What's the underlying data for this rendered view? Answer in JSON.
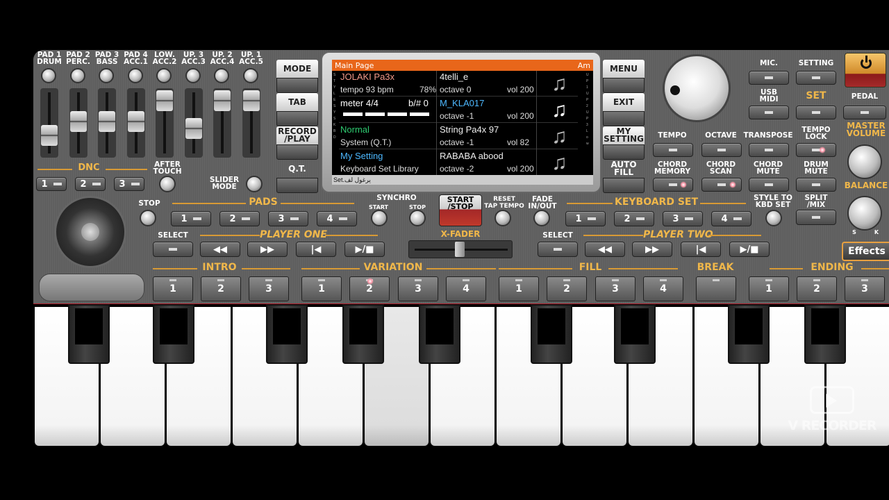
{
  "top_sliders": [
    {
      "label": "PAD 1\nDRUM"
    },
    {
      "label": "PAD 2\nPERC."
    },
    {
      "label": "PAD 3\nBASS"
    },
    {
      "label": "PAD 4\nACC.1"
    },
    {
      "label": "LOW.\nACC.2"
    },
    {
      "label": "UP. 3\nACC.3"
    },
    {
      "label": "UP. 2\nACC.4"
    },
    {
      "label": "UP. 1\nACC.5"
    }
  ],
  "dnc": {
    "label": "DNC",
    "buttons": [
      "1",
      "2",
      "3"
    ]
  },
  "after_touch": "AFTER\nTOUCH",
  "slider_mode": "SLIDER\nMODE",
  "left_col": {
    "mode": "MODE",
    "tab": "TAB",
    "record": "RECORD\n/PLAY",
    "qt": "Q.T."
  },
  "right_col": {
    "menu": "MENU",
    "exit": "EXIT",
    "my_setting": "MY\nSETTING",
    "auto_fill": "AUTO\nFILL"
  },
  "screen": {
    "header": "Main Page",
    "chord": "Am",
    "left_tags": [
      "S",
      "T",
      "Y",
      "L",
      "E",
      "S",
      "Y",
      "S",
      "K",
      "B",
      "D"
    ],
    "right_tags": [
      "U",
      "P",
      "1",
      "U",
      "P",
      "2",
      "U",
      "P",
      "3",
      "L",
      "o",
      "w"
    ],
    "style_name": "JOLAKI  Pa3x",
    "tempo": "tempo 93 bpm",
    "tempo_pct": "78%",
    "meter": "meter 4/4",
    "key": "b/# 0",
    "performance": "Normal",
    "perf_sub": "System (Q.T.)",
    "kbd_set": "My Setting",
    "kbd_sub": "Keyboard Set Library",
    "tracks": [
      {
        "name": "4telli_e",
        "octave": "octave 0",
        "vol": "vol 200"
      },
      {
        "name": "M_KLA017",
        "octave": "octave -1",
        "vol": "vol 200"
      },
      {
        "name": "String Pa4x 97",
        "octave": "octave -1",
        "vol": "vol 82"
      },
      {
        "name": "RABABA abood",
        "octave": "octave -2",
        "vol": "vol 200"
      }
    ],
    "footer": "Set.يرغول لف"
  },
  "right_panel": {
    "mic": "MIC.",
    "setting": "SETTING",
    "usb_midi": "USB\nMIDI",
    "set": "SET",
    "pedal": "PEDAL",
    "tempo": "TEMPO",
    "octave": "OCTAVE",
    "transpose": "TRANSPOSE",
    "tempo_lock": "TEMPO\nLOCK",
    "chord_memory": "CHORD\nMEMORY",
    "chord_scan": "CHORD\nSCAN",
    "chord_mute": "CHORD\nMUTE",
    "drum_mute": "DRUM\nMUTE",
    "master_volume": "MASTER\nVOLUME",
    "balance": "BALANCE",
    "balance_s": "S",
    "balance_k": "K",
    "effects": "Effects",
    "style_to_kbd": "STYLE TO\nKBD SET",
    "split_mix": "SPLIT\n/MIX"
  },
  "pads": {
    "label": "PADS",
    "stop": "STOP",
    "buttons": [
      "1",
      "2",
      "3",
      "4"
    ]
  },
  "synchro": {
    "label": "SYNCHRO",
    "start": "START",
    "stop": "STOP"
  },
  "start_stop": "START\n/STOP",
  "reset": "RESET\nTAP TEMPO",
  "fade": "FADE\nIN/OUT",
  "keyboard_set": {
    "label": "KEYBOARD SET",
    "buttons": [
      "1",
      "2",
      "3",
      "4"
    ]
  },
  "player_one": {
    "label": "PLAYER ONE",
    "select": "SELECT"
  },
  "player_two": {
    "label": "PLAYER TWO",
    "select": "SELECT"
  },
  "xfader": "X-FADER",
  "intro": {
    "label": "INTRO",
    "buttons": [
      "1",
      "2",
      "3"
    ]
  },
  "variation": {
    "label": "VARIATION",
    "buttons": [
      "1",
      "2",
      "3",
      "4"
    ]
  },
  "fill": {
    "label": "FILL",
    "buttons": [
      "1",
      "2",
      "3",
      "4"
    ]
  },
  "break": "BREAK",
  "ending": {
    "label": "ENDING",
    "buttons": [
      "1",
      "2",
      "3"
    ]
  },
  "watermark": "V RECORDER",
  "colors": {
    "accent": "#f0b74a",
    "lcd_header": "#e8661a",
    "start_red": "#c0392b"
  }
}
